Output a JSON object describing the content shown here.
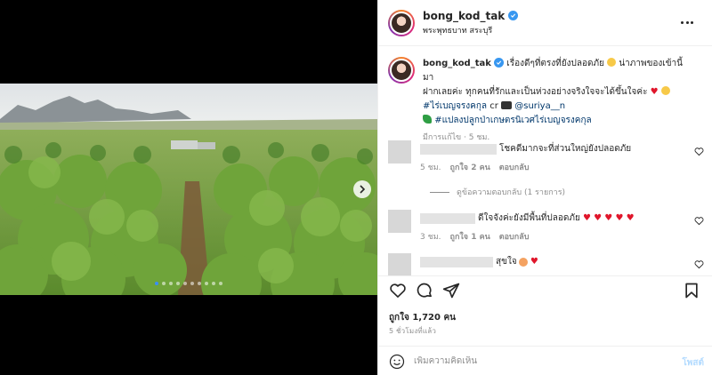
{
  "media": {
    "carousel_count": 10,
    "active_index": 0,
    "next_icon": "chevron-right-icon"
  },
  "header": {
    "username": "bong_kod_tak",
    "verified": true,
    "location": "พระพุทธบาท สระบุรี",
    "more_icon": "more-horizontal-icon"
  },
  "caption": {
    "username": "bong_kod_tak",
    "line1": "เรื่องดีๆที่ตรงที่ยังปลอดภัย",
    "line1b": "น่าภาพของเข้านี้มา",
    "line2": "ฝากเลยค่ะ ทุกคนที่รักและเป็นห่วงอย่างจริงใจจะได้ขึ้นใจค่ะ",
    "hashtag1": "#ไร่เบญจรงคกุล",
    "credit_prefix": "cr",
    "credit_user": "@suriya__n",
    "hashtag2": "#แปลงปลูกป่าเกษตรนิเวศไร่เบญจรงคกุล",
    "meta": "มีการแก้ไข · 5 ชม."
  },
  "comments": [
    {
      "text": "โชคดีมากจะที่ส่วนใหญ่ยังปลอดภัย",
      "time": "5 ชม.",
      "likes": "ถูกใจ 2 คน",
      "reply": "ตอบกลับ"
    },
    {
      "text": "ดีใจจังค่ะยังมีพื้นที่ปลอดภัย",
      "time": "3 ชม.",
      "likes": "ถูกใจ 1 คน",
      "reply": "ตอบกลับ"
    },
    {
      "text": "สุขใจ"
    }
  ],
  "view_replies": "ดูข้อความตอบกลับ (1 รายการ)",
  "actions": {
    "likes": "ถูกใจ 1,720 คน",
    "time": "5 ชั่วโมงที่แล้ว"
  },
  "add_comment": {
    "placeholder": "เพิ่มความคิดเห็น",
    "post_label": "โพสต์"
  }
}
